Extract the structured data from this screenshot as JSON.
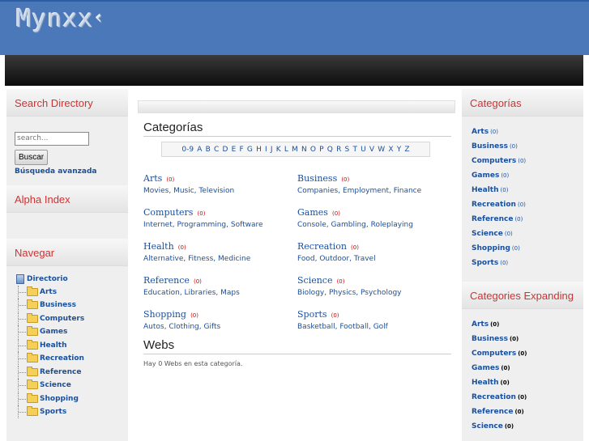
{
  "logo": {
    "text": "Mynxx",
    "arrow": "‹"
  },
  "left": {
    "search_heading": "Search Directory",
    "search_placeholder": "search...",
    "search_button": "Buscar",
    "advanced_link": "Búsqueda avanzada",
    "alpha_heading": "Alpha Index",
    "nav_heading": "Navegar",
    "tree_root": "Directorio",
    "tree_items": [
      "Arts",
      "Business",
      "Computers",
      "Games",
      "Health",
      "Recreation",
      "Reference",
      "Science",
      "Shopping",
      "Sports"
    ]
  },
  "main": {
    "title": "Categorías",
    "alpha": [
      "0-9",
      "A",
      "B",
      "C",
      "D",
      "E",
      "F",
      "G",
      "H",
      "I",
      "J",
      "K",
      "L",
      "M",
      "N",
      "O",
      "P",
      "Q",
      "R",
      "S",
      "T",
      "U",
      "V",
      "W",
      "X",
      "Y",
      "Z"
    ],
    "categories": [
      {
        "name": "Arts",
        "count": "(0)",
        "subs": [
          "Movies",
          "Music",
          "Television"
        ]
      },
      {
        "name": "Business",
        "count": "(0)",
        "subs": [
          "Companies",
          "Employment",
          "Finance"
        ]
      },
      {
        "name": "Computers",
        "count": "(0)",
        "subs": [
          "Internet",
          "Programming",
          "Software"
        ]
      },
      {
        "name": "Games",
        "count": "(0)",
        "subs": [
          "Console",
          "Gambling",
          "Roleplaying"
        ]
      },
      {
        "name": "Health",
        "count": "(0)",
        "subs": [
          "Alternative",
          "Fitness",
          "Medicine"
        ]
      },
      {
        "name": "Recreation",
        "count": "(0)",
        "subs": [
          "Food",
          "Outdoor",
          "Travel"
        ]
      },
      {
        "name": "Reference",
        "count": "(0)",
        "subs": [
          "Education",
          "Libraries",
          "Maps"
        ]
      },
      {
        "name": "Science",
        "count": "(0)",
        "subs": [
          "Biology",
          "Physics",
          "Psychology"
        ]
      },
      {
        "name": "Shopping",
        "count": "(0)",
        "subs": [
          "Autos",
          "Clothing",
          "Gifts"
        ]
      },
      {
        "name": "Sports",
        "count": "(0)",
        "subs": [
          "Basketball",
          "Football",
          "Golf"
        ]
      }
    ],
    "webs_title": "Webs",
    "webs_text": "Hay 0 Webs en esta categoría."
  },
  "right": {
    "categorias_heading": "Categorías",
    "categorias": [
      {
        "name": "Arts",
        "count": "(0)"
      },
      {
        "name": "Business",
        "count": "(0)"
      },
      {
        "name": "Computers",
        "count": "(0)"
      },
      {
        "name": "Games",
        "count": "(0)"
      },
      {
        "name": "Health",
        "count": "(0)"
      },
      {
        "name": "Recreation",
        "count": "(0)"
      },
      {
        "name": "Reference",
        "count": "(0)"
      },
      {
        "name": "Science",
        "count": "(0)"
      },
      {
        "name": "Shopping",
        "count": "(0)"
      },
      {
        "name": "Sports",
        "count": "(0)"
      }
    ],
    "expanding_heading": "Categories Expanding",
    "expanding": [
      {
        "name": "Arts",
        "count": "(0)"
      },
      {
        "name": "Business",
        "count": "(0)"
      },
      {
        "name": "Computers",
        "count": "(0)"
      },
      {
        "name": "Games",
        "count": "(0)"
      },
      {
        "name": "Health",
        "count": "(0)"
      },
      {
        "name": "Recreation",
        "count": "(0)"
      },
      {
        "name": "Reference",
        "count": "(0)"
      },
      {
        "name": "Science",
        "count": "(0)"
      }
    ]
  }
}
